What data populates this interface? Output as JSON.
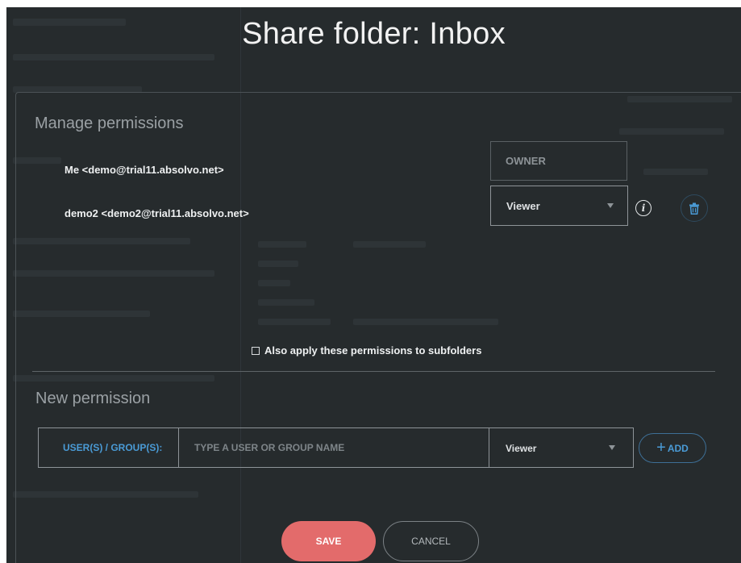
{
  "dialog": {
    "title": "Share folder: Inbox"
  },
  "manage": {
    "heading": "Manage permissions",
    "entries": [
      {
        "name": "Me <demo@trial11.absolvo.net>",
        "role": "OWNER"
      },
      {
        "name": "demo2 <demo2@trial11.absolvo.net>",
        "role": "Viewer"
      }
    ],
    "subfolders_label": "Also apply these permissions to subfolders",
    "subfolders_checked": false
  },
  "new_permission": {
    "heading": "New permission",
    "user_label": "USER(S) / GROUP(S):",
    "input_placeholder": "TYPE A USER OR GROUP NAME",
    "input_value": "",
    "role": "Viewer",
    "add_label": "ADD"
  },
  "actions": {
    "save_label": "SAVE",
    "cancel_label": "CANCEL"
  },
  "icons": {
    "info": "info-icon",
    "delete": "trash-icon",
    "dropdown": "caret-down-icon",
    "add": "plus-icon"
  },
  "colors": {
    "overlay": "#262b2d",
    "accent_blue": "#4a9bd6",
    "save": "#e36b6b",
    "text": "#eef0f1"
  }
}
